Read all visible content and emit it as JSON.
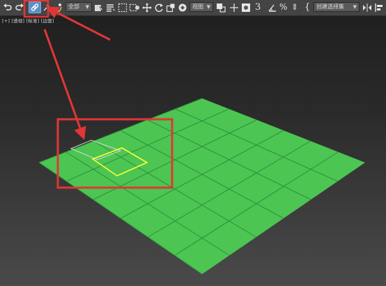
{
  "toolbar": {
    "select_filter": "全部",
    "ref_coord": "视图",
    "named_selection": "创建选择集",
    "icons": [
      "undo-icon",
      "redo-icon",
      "link-icon",
      "unlink-icon",
      "bind-space-warp-icon",
      "select-object-icon",
      "select-by-name-icon",
      "rect-selection-icon",
      "window-crossing-icon",
      "move-icon",
      "rotate-icon",
      "scale-icon",
      "select-place-icon",
      "pivot-icon",
      "keyboard-shortcut-icon",
      "snap-3d-icon",
      "angle-snap-icon",
      "percent-snap-icon",
      "spinner-snap-icon",
      "edit-named-sets-icon",
      "mirror-icon"
    ],
    "snap_label": "3",
    "percent_glyph": "%",
    "spinner_glyph": "⇕",
    "brace_glyph": "{"
  },
  "viewport": {
    "label": "[+] [透视] [标准] [边面]",
    "plane_color": "#4cc553",
    "grid_line_color": "#2f8f3a",
    "selected_face_color": "#ffff3a",
    "highlight_edge_color": "#d8d8d8"
  },
  "annotations": {
    "color": "#e23636"
  }
}
